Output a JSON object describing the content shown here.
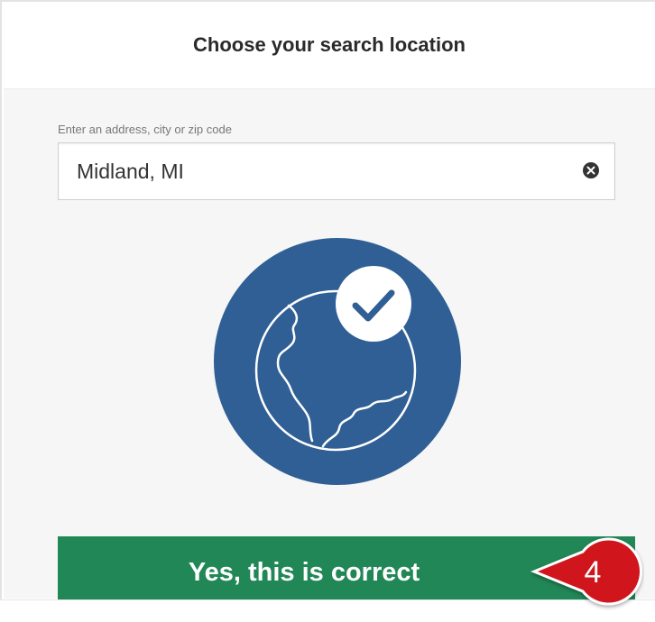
{
  "header": {
    "title": "Choose your search location"
  },
  "search": {
    "label": "Enter an address, city or zip code",
    "value": "Midland, MI",
    "clear_icon": "clear-icon"
  },
  "illustration": {
    "icon": "globe-check-icon"
  },
  "cta": {
    "label": "Yes, this is correct"
  },
  "step_badge": {
    "number": "4"
  },
  "colors": {
    "accent_green": "#218757",
    "globe_blue": "#2f5f94",
    "badge_red": "#d0161c"
  }
}
